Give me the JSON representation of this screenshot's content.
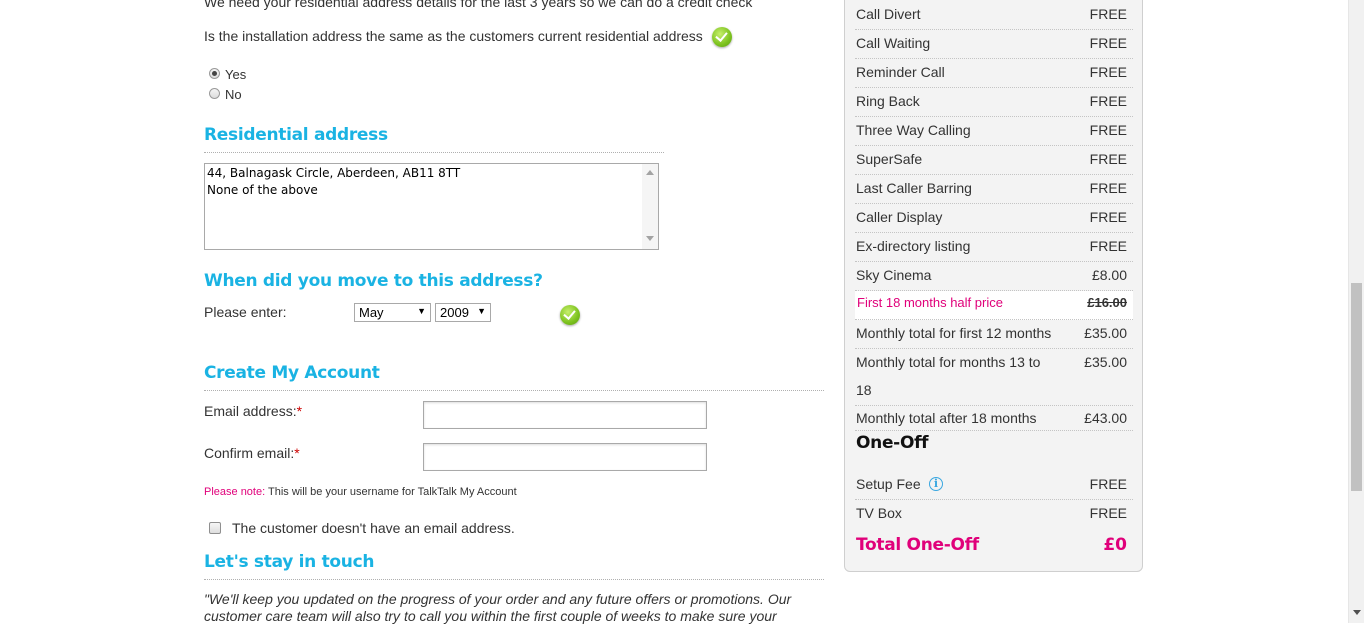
{
  "form": {
    "intro_text": "We need your residential address details for the last 3 years so we can do a credit check",
    "same_address_question": "Is the installation address the same as the customers current residential address",
    "radio_yes": "Yes",
    "radio_no": "No",
    "residential_heading": "Residential address",
    "address_options": [
      "44, Balnagask Circle, Aberdeen, AB11 8TT",
      "None of the above"
    ],
    "move_heading": "When did you move to this address?",
    "please_enter": "Please enter:",
    "month_value": "May",
    "year_value": "2009",
    "account_heading": "Create My Account",
    "email_label": "Email address:",
    "confirm_label": "Confirm email:",
    "required_mark": "*",
    "note_label": "Please note:",
    "note_text": "This will be your username for TalkTalk My Account",
    "no_email_label": "The customer doesn't have an email address.",
    "touch_heading": "Let's stay in touch",
    "touch_text_1": "\"We'll keep you updated on the progress of your order and any future offers or promotions. Our",
    "touch_text_2": "customer care team will also try to call you within the first couple of weeks to make sure your"
  },
  "summary": {
    "rows": [
      {
        "label": "Call Divert",
        "value": "FREE"
      },
      {
        "label": "Call Waiting",
        "value": "FREE"
      },
      {
        "label": "Reminder Call",
        "value": "FREE"
      },
      {
        "label": "Ring Back",
        "value": "FREE"
      },
      {
        "label": "Three Way Calling",
        "value": "FREE"
      },
      {
        "label": "SuperSafe",
        "value": "FREE"
      },
      {
        "label": "Last Caller Barring",
        "value": "FREE"
      },
      {
        "label": "Caller Display",
        "value": "FREE"
      },
      {
        "label": "Ex-directory listing",
        "value": "FREE"
      },
      {
        "label": "Sky Cinema",
        "value": "£8.00"
      }
    ],
    "promo_label": "First 18 months half price",
    "promo_value": "£16.00",
    "monthly_first12_label": "Monthly total for first 12 months",
    "monthly_first12_value": "£35.00",
    "monthly_13_18_label_1": "Monthly total for months 13 to",
    "monthly_13_18_label_2": "18",
    "monthly_13_18_value": "£35.00",
    "monthly_after_label": "Monthly total after 18 months",
    "monthly_after_value": "£43.00",
    "oneoff_heading": "One-Off",
    "setup_label": "Setup Fee",
    "setup_value": "FREE",
    "tvbox_label": "TV Box",
    "tvbox_value": "FREE",
    "total_label": "Total One-Off",
    "total_value": "£0"
  },
  "colors": {
    "heading_blue": "#1ab3e3",
    "pink": "#e0007a",
    "check_green": "#7cc21e"
  },
  "icons": [
    "check-icon",
    "info-icon",
    "dropdown-arrow-icon"
  ]
}
